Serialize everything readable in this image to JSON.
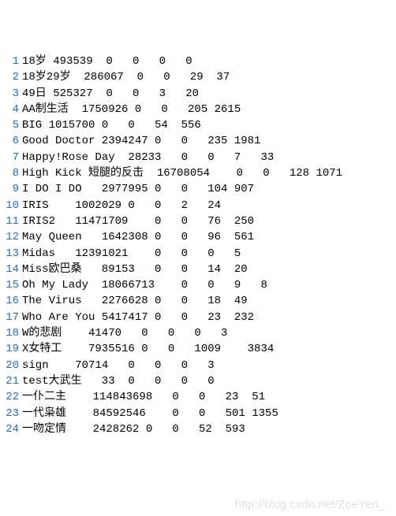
{
  "watermark": "http://blog.csdn.net/ZoeYen_",
  "lines": [
    {
      "num": 1,
      "text": "18岁 493539  0   0   0   0"
    },
    {
      "num": 2,
      "text": "18岁29岁  286067  0   0   29  37"
    },
    {
      "num": 3,
      "text": "49日 525327  0   0   3   20"
    },
    {
      "num": 4,
      "text": "AA制生活  1750926 0   0   205 2615"
    },
    {
      "num": 5,
      "text": "BIG 1015700 0   0   54  556"
    },
    {
      "num": 6,
      "text": "Good Doctor 2394247 0   0   235 1981"
    },
    {
      "num": 7,
      "text": "Happy!Rose Day  28233   0   0   7   33"
    },
    {
      "num": 8,
      "text": "High Kick 短腿的反击  16708054    0   0   128 1071"
    },
    {
      "num": 9,
      "text": "I DO I DO   2977995 0   0   104 907"
    },
    {
      "num": 10,
      "text": "IRIS    1002029 0   0   2   24"
    },
    {
      "num": 11,
      "text": "IRIS2   11471709    0   0   76  250"
    },
    {
      "num": 12,
      "text": "May Queen   1642308 0   0   96  561"
    },
    {
      "num": 13,
      "text": "Midas   12391021    0   0   0   5"
    },
    {
      "num": 14,
      "text": "Miss欧巴桑   89153   0   0   14  20"
    },
    {
      "num": 15,
      "text": "Oh My Lady  18066713    0   0   9   8"
    },
    {
      "num": 16,
      "text": "The Virus   2276628 0   0   18  49"
    },
    {
      "num": 17,
      "text": "Who Are You 5417417 0   0   23  232"
    },
    {
      "num": 18,
      "text": "W的悲剧    41470   0   0   0   3"
    },
    {
      "num": 19,
      "text": "X女特工    7935516 0   0   1009    3834"
    },
    {
      "num": 20,
      "text": "sign    70714   0   0   0   3"
    },
    {
      "num": 21,
      "text": "test大武生   33  0   0   0   0"
    },
    {
      "num": 22,
      "text": "一仆二主    114843698   0   0   23  51"
    },
    {
      "num": 23,
      "text": "一代枭雄    84592546    0   0   501 1355"
    },
    {
      "num": 24,
      "text": "一吻定情    2428262 0   0   52  593"
    }
  ]
}
